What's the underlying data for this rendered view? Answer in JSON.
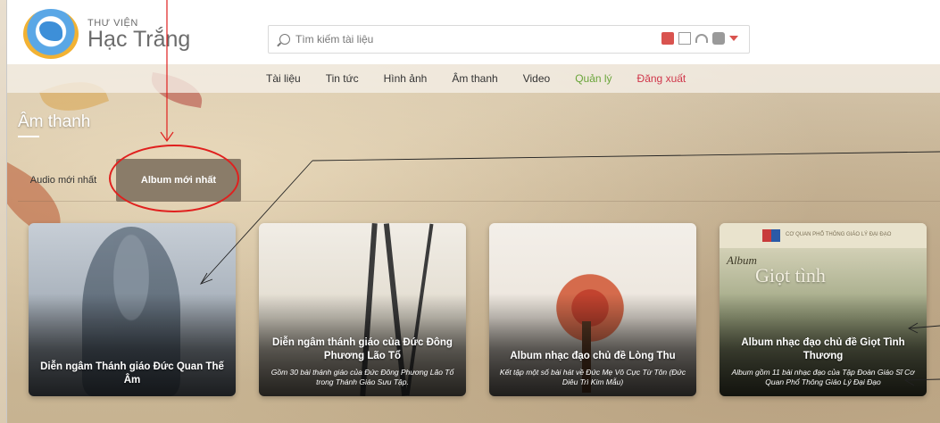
{
  "logo": {
    "small": "THƯ VIỆN",
    "big": "Hạc Trắng"
  },
  "search": {
    "placeholder": "Tìm kiếm tài liệu"
  },
  "nav": [
    {
      "label": "Tài liệu"
    },
    {
      "label": "Tin tức"
    },
    {
      "label": "Hình ảnh"
    },
    {
      "label": "Âm thanh"
    },
    {
      "label": "Video"
    },
    {
      "label": "Quản lý"
    },
    {
      "label": "Đăng xuất"
    }
  ],
  "page_title": "Âm thanh",
  "tabs": {
    "audio": "Audio mới nhất",
    "album": "Album mới nhất"
  },
  "cards": [
    {
      "title": "Diễn ngâm Thánh giáo Đức Quan Thế Âm",
      "desc": ""
    },
    {
      "title": "Diễn ngâm thánh giáo của Đức Đông Phương Lão Tổ",
      "desc": "Gồm 30 bài thánh giáo của Đức Đông Phương Lão Tổ trong Thánh Giáo Sưu Tập."
    },
    {
      "title": "Album nhạc đạo chủ đề Lòng Thu",
      "desc": "Kết tập một số bài hát về Đức Mẹ Vô Cực Từ Tôn (Đức Diêu Trì Kim Mẫu)"
    },
    {
      "title": "Album nhạc đạo chủ đề Giọt Tình Thương",
      "desc": "Album gồm 11 bài nhạc đạo của Tập Đoàn Giáo Sĩ Cơ Quan Phổ Thông Giáo Lý Đại Đạo"
    }
  ],
  "card4_art": {
    "publisher": "CƠ QUAN PHỔ THÔNG GIÁO LÝ ĐẠI ĐẠO",
    "album_word": "Album",
    "big_text": "Giọt tình"
  },
  "colors": {
    "active_tab": "#8a7c69",
    "manage": "#6aa53a",
    "logout": "#d0364a",
    "annotation": "#e0201e"
  }
}
